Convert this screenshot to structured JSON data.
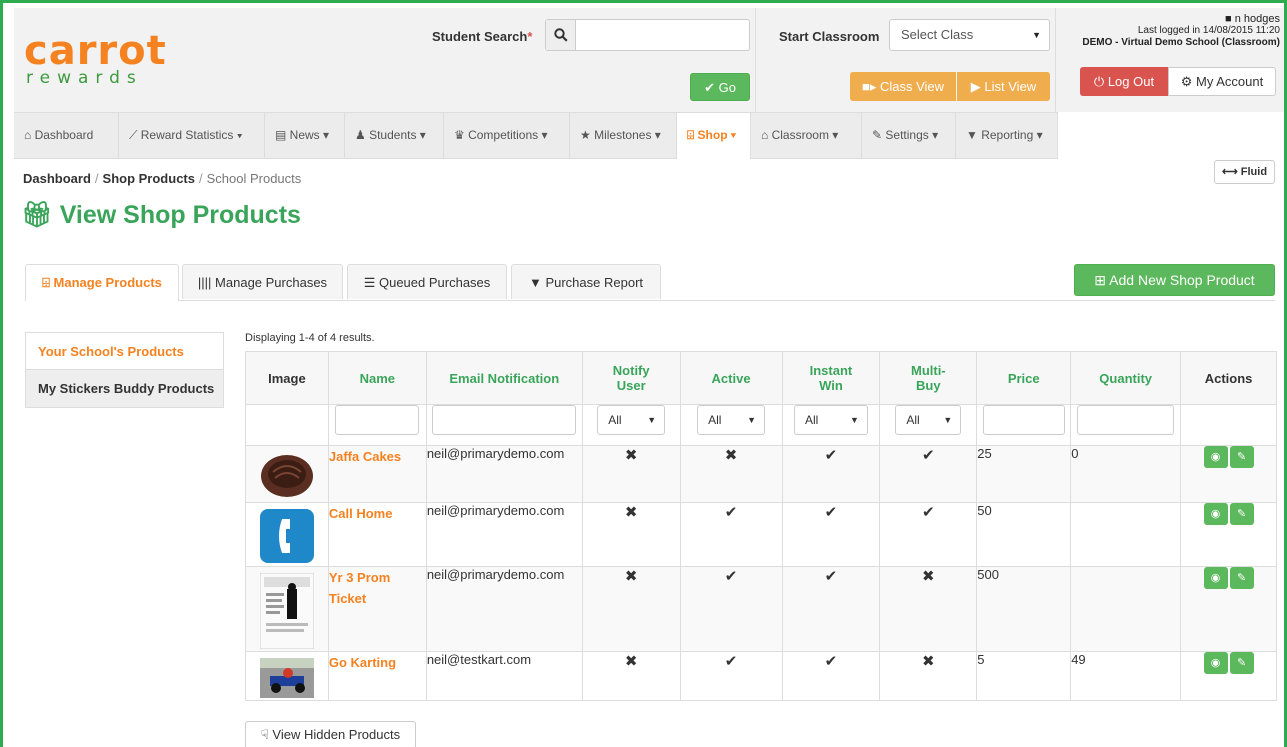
{
  "brand": {
    "logo_top": "carrot",
    "logo_bottom": "rewards",
    "accent": "#f58220",
    "green": "#3aa55a"
  },
  "search": {
    "label": "Student Search",
    "required_mark": "*",
    "placeholder": "",
    "go_label": "Go"
  },
  "classroom": {
    "label": "Start Classroom",
    "selected": "Select Class",
    "class_view_label": "Class View",
    "list_view_label": "List View"
  },
  "user": {
    "name": "n hodges",
    "last_login": "Last logged in 14/08/2015 11:20",
    "school": "DEMO - Virtual Demo School (Classroom)",
    "logout_label": "Log Out",
    "account_label": "My Account"
  },
  "nav": {
    "items": [
      {
        "label": "Dashboard",
        "icon": "home-icon"
      },
      {
        "label": "Reward Statistics",
        "icon": "chart-icon"
      },
      {
        "label": "News",
        "icon": "newspaper-icon"
      },
      {
        "label": "Students",
        "icon": "users-icon"
      },
      {
        "label": "Competitions",
        "icon": "trophy-icon"
      },
      {
        "label": "Milestones",
        "icon": "star-icon"
      },
      {
        "label": "Shop",
        "icon": "gift-icon"
      },
      {
        "label": "Classroom",
        "icon": "graduation-cap-icon"
      },
      {
        "label": "Settings",
        "icon": "wrench-icon"
      },
      {
        "label": "Reporting",
        "icon": "filter-icon"
      }
    ]
  },
  "breadcrumb": {
    "home": "Dashboard",
    "section": "Shop Products",
    "current": "School Products"
  },
  "fluid_label": "Fluid",
  "page_title": "View Shop Products",
  "tabs": [
    "Manage Products",
    "Manage Purchases",
    "Queued Purchases",
    "Purchase Report"
  ],
  "add_button_label": "Add New Shop Product",
  "sidebar": {
    "items": [
      "Your School's Products",
      "My Stickers Buddy Products"
    ]
  },
  "results_text": "Displaying 1-4 of 4 results.",
  "table": {
    "headers": [
      "Image",
      "Name",
      "Email Notification",
      "Notify User",
      "Active",
      "Instant Win",
      "Multi-Buy",
      "Price",
      "Quantity",
      "Actions"
    ],
    "filter_all": "All",
    "rows": [
      {
        "name": "Jaffa Cakes",
        "email": "neil@primarydemo.com",
        "notify": "✖",
        "active": "✖",
        "instant": "✔",
        "multi": "✔",
        "price": "25",
        "quantity": "0",
        "image": "jaffa-cake-image"
      },
      {
        "name": "Call Home",
        "email": "neil@primarydemo.com",
        "notify": "✖",
        "active": "✔",
        "instant": "✔",
        "multi": "✔",
        "price": "50",
        "quantity": "",
        "image": "phone-image"
      },
      {
        "name": "Yr 3 Prom Ticket",
        "email": "neil@primarydemo.com",
        "notify": "✖",
        "active": "✔",
        "instant": "✔",
        "multi": "✖",
        "price": "500",
        "quantity": "",
        "image": "prom-ticket-image"
      },
      {
        "name": "Go Karting",
        "email": "neil@testkart.com",
        "notify": "✖",
        "active": "✔",
        "instant": "✔",
        "multi": "✖",
        "price": "5",
        "quantity": "49",
        "image": "go-kart-image"
      }
    ]
  },
  "hidden_products_label": "View Hidden Products"
}
